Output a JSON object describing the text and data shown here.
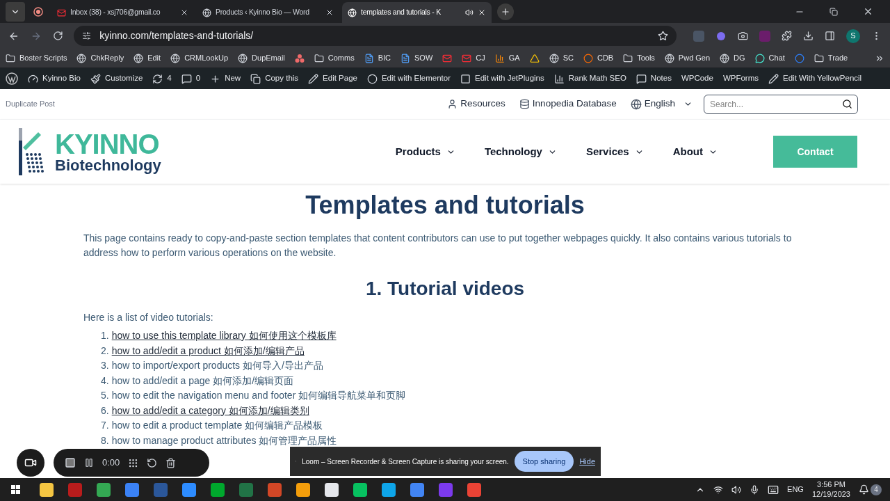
{
  "browser": {
    "tabs": [
      {
        "title": "Inbox (38) - xsj706@gmail.co",
        "kind": "mail",
        "selected": false
      },
      {
        "title": "Products ‹ Kyinno Bio — Word",
        "kind": "globe",
        "selected": false
      },
      {
        "title": "templates and tutorials - K",
        "kind": "globe",
        "selected": true
      }
    ],
    "url": "kyinno.com/templates-and-tutorials/",
    "profile": "S",
    "bookmarks": [
      {
        "label": "Boster Scripts",
        "kind": "folder"
      },
      {
        "label": "ChkReply",
        "kind": "globe"
      },
      {
        "label": "Edit",
        "kind": "globe"
      },
      {
        "label": "CRMLookUp",
        "kind": "globe"
      },
      {
        "label": "DupEmail",
        "kind": "globe"
      },
      {
        "kind": "dots"
      },
      {
        "label": "Comms",
        "kind": "folder"
      },
      {
        "label": "BIC",
        "kind": "doc"
      },
      {
        "label": "SOW",
        "kind": "doc"
      },
      {
        "kind": "mail"
      },
      {
        "label": "CJ",
        "kind": "mail"
      },
      {
        "label": "GA",
        "kind": "chart"
      },
      {
        "kind": "triangle"
      },
      {
        "label": "SC",
        "kind": "globe"
      },
      {
        "label": "CDB",
        "kind": "cp"
      },
      {
        "label": "Tools",
        "kind": "folder"
      },
      {
        "label": "Pwd Gen",
        "kind": "globe"
      },
      {
        "label": "DG",
        "kind": "globe"
      },
      {
        "label": "Chat",
        "kind": "chat"
      },
      {
        "kind": "circle"
      },
      {
        "label": "Trade",
        "kind": "folder"
      }
    ]
  },
  "admin_bar": [
    {
      "label": "Kyinno Bio",
      "kind": "gauge"
    },
    {
      "label": "Customize",
      "kind": "brush"
    },
    {
      "label": "4",
      "kind": "refresh"
    },
    {
      "label": "0",
      "kind": "comment"
    },
    {
      "label": "New",
      "kind": "plus"
    },
    {
      "label": "Copy this",
      "kind": "copy"
    },
    {
      "label": "Edit Page",
      "kind": "pencil"
    },
    {
      "label": "Edit with Elementor",
      "kind": "elementor"
    },
    {
      "label": "Edit with JetPlugins",
      "kind": "jet"
    },
    {
      "label": "Rank Math SEO",
      "kind": "chart"
    },
    {
      "label": "Notes",
      "kind": "comment"
    },
    {
      "label": "WPCode"
    },
    {
      "label": "WPForms"
    },
    {
      "label": "Edit With YellowPencil",
      "kind": "pencil"
    }
  ],
  "duplicate_post": "Duplicate Post",
  "topbar": {
    "links": [
      {
        "label": "Resources",
        "kind": "user"
      },
      {
        "label": "Innopedia Database",
        "kind": "database"
      }
    ],
    "language": "English",
    "search": {
      "placeholder": "Search..."
    }
  },
  "logo": {
    "name": "KYINNO",
    "tagline": "Biotechnology"
  },
  "nav": [
    "Products",
    "Technology",
    "Services",
    "About"
  ],
  "contact": "Contact",
  "title": "Templates and tutorials",
  "intro": "This page contains ready to copy-and-paste section templates that content contributors can use to put together webpages quickly. It also contains various tutorials to address how to perform various operations on the website.",
  "section": "1. Tutorial videos",
  "list_intro": "Here is a list of video tutorials:",
  "tutorials": [
    {
      "number": "1.",
      "text": "how to use this template library 如何使用这个模板库",
      "underlined": true
    },
    {
      "number": "2.",
      "text": "how to add/edit a product 如何添加/编辑产品",
      "underlined": true
    },
    {
      "number": "3.",
      "text": "how to import/export products 如何导入/导出产品",
      "underlined": false
    },
    {
      "number": "4.",
      "text": "how to add/edit a page 如何添加/编辑页面",
      "underlined": false
    },
    {
      "number": "5.",
      "text": "how to edit the navigation menu and footer 如何编辑导航菜单和页脚",
      "underlined": false
    },
    {
      "number": "6.",
      "text": "how to add/edit a category 如何添加/编辑类别",
      "underlined": true
    },
    {
      "number": "7.",
      "text": "how to edit a product template 如何编辑产品模板",
      "underlined": false
    },
    {
      "number": "8.",
      "text": "how to manage product attributes 如何管理产品属性",
      "underlined": false
    }
  ],
  "recorder": {
    "time": "0:00"
  },
  "loom": {
    "message": "Loom – Screen Recorder & Screen Capture is sharing your screen.",
    "stop": "Stop sharing",
    "hide": "Hide"
  },
  "taskbar": {
    "apps": [
      {
        "color": "#f4c542"
      },
      {
        "color": "#b91c1c"
      },
      {
        "color": "#34a853"
      },
      {
        "color": "#3b82f6"
      },
      {
        "color": "#2b579a"
      },
      {
        "color": "#2d8cff"
      },
      {
        "color": "#00a82d"
      },
      {
        "color": "#217346"
      },
      {
        "color": "#d24726"
      },
      {
        "color": "#f59e0b"
      },
      {
        "color": "#e5e7eb"
      },
      {
        "color": "#07c160"
      },
      {
        "color": "#0ea5e9"
      },
      {
        "color": "#4285f4"
      },
      {
        "color": "#7c3aed"
      },
      {
        "color": "#ea4335"
      }
    ],
    "language": "ENG",
    "time": "3:56 PM",
    "date": "12/19/2023",
    "notifications": "4"
  }
}
